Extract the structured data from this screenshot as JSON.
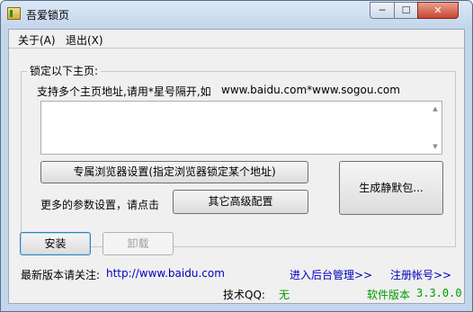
{
  "window": {
    "title": "吾爱锁页",
    "min_glyph": "─",
    "max_glyph": "☐",
    "close_glyph": "✕"
  },
  "menu": {
    "about": "关于(A)",
    "exit": "退出(X)"
  },
  "lock_group": {
    "title": "锁定以下主页:",
    "hint": "支持多个主页地址,请用*星号隔开,如",
    "example": "www.baidu.com*www.sogou.com",
    "urls_value": "",
    "scroll_up": "▲",
    "scroll_down": "▼",
    "browser_button": "专属浏览器设置(指定浏览器锁定某个地址)",
    "more_label": "更多的参数设置，请点击",
    "advanced_button": "其它高级配置",
    "silent_button": "生成静默包..."
  },
  "actions": {
    "install": "安装",
    "uninstall": "卸载"
  },
  "footer": {
    "latest_label": "最新版本请关注:",
    "latest_url": "http://www.baidu.com",
    "backend_link": "进入后台管理>>",
    "register_link": "注册帐号>>",
    "qq_label": "技术QQ:",
    "qq_value": "无",
    "version_label": "软件版本",
    "version_value": "3.3.0.0"
  },
  "colors": {
    "link": "#0000c0",
    "green": "#009900"
  }
}
